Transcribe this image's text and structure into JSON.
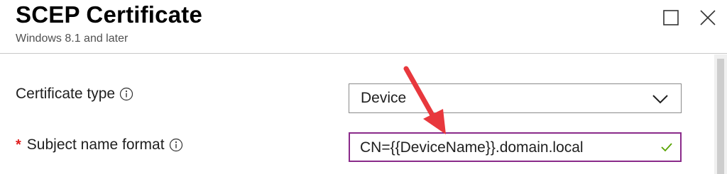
{
  "blade": {
    "title": "SCEP Certificate",
    "subtitle": "Windows 8.1 and later"
  },
  "window_controls": {
    "maximize_icon": "maximize-icon",
    "close_icon": "close-icon"
  },
  "form": {
    "certificate_type": {
      "label": "Certificate type",
      "info_icon": "info-icon",
      "selected_value": "Device",
      "dropdown_icon": "chevron-down-icon"
    },
    "subject_name_format": {
      "required_marker": "*",
      "label": "Subject name format",
      "info_icon": "info-icon",
      "value": "CN={{DeviceName}}.domain.local",
      "valid_icon": "checkmark-icon"
    }
  },
  "annotation": {
    "icon": "red-arrow-annotation"
  },
  "colors": {
    "required": "#e01e1e",
    "focused_border": "#8a2a8a",
    "valid_check": "#57a300",
    "annotation_arrow": "#e8383d"
  }
}
